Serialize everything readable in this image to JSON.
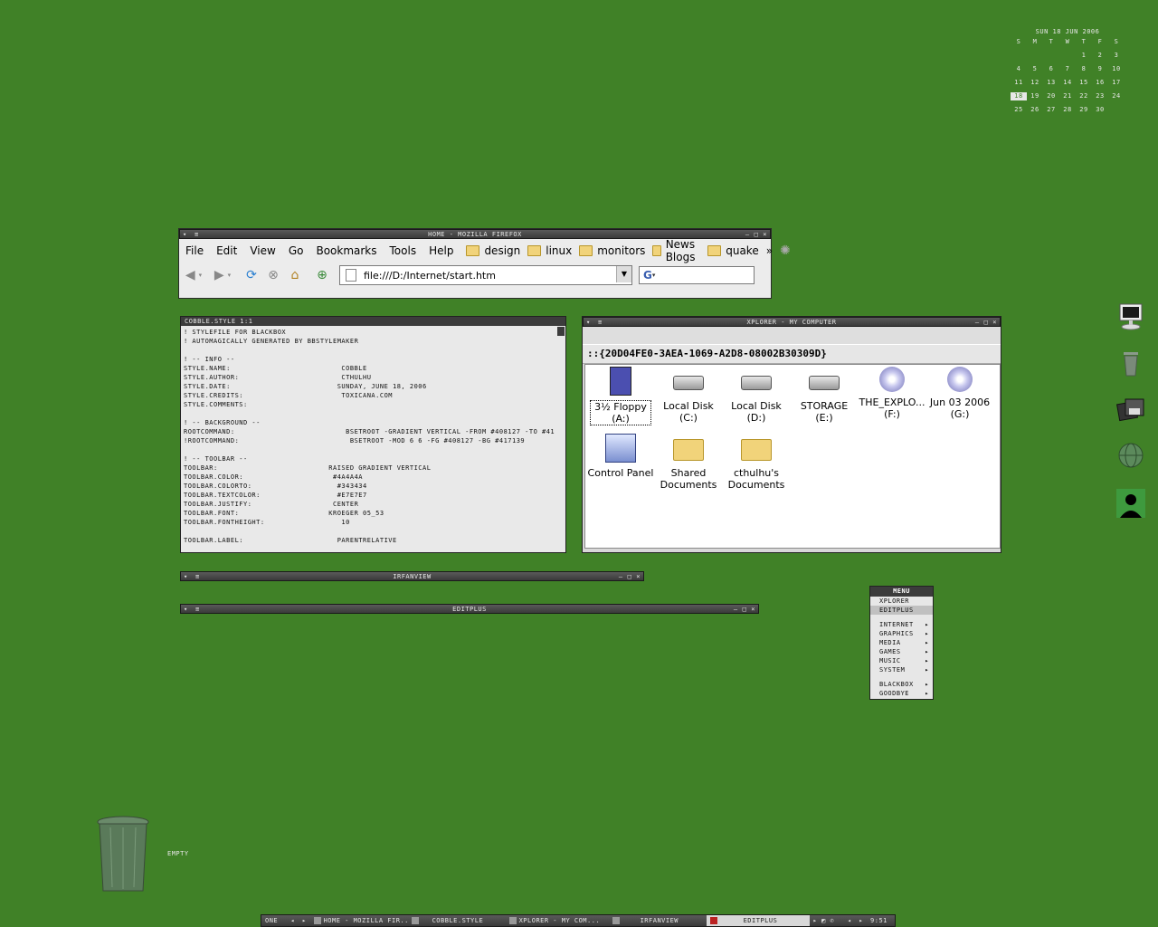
{
  "calendar": {
    "title": "Sun 18 Jun 2006",
    "dow": [
      "S",
      "M",
      "T",
      "W",
      "T",
      "F",
      "S"
    ],
    "weeks": [
      [
        "",
        "",
        "",
        "",
        "1",
        "2",
        "3"
      ],
      [
        "4",
        "5",
        "6",
        "7",
        "8",
        "9",
        "10"
      ],
      [
        "11",
        "12",
        "13",
        "14",
        "15",
        "16",
        "17"
      ],
      [
        "18",
        "19",
        "20",
        "21",
        "22",
        "23",
        "24"
      ],
      [
        "25",
        "26",
        "27",
        "28",
        "29",
        "30",
        ""
      ]
    ],
    "today": "18"
  },
  "firefox": {
    "title": "Home - Mozilla Firefox",
    "menu": [
      "File",
      "Edit",
      "View",
      "Go",
      "Bookmarks",
      "Tools",
      "Help"
    ],
    "bookmarks": [
      "design",
      "linux",
      "monitors",
      "News Blogs",
      "quake"
    ],
    "overflow": "»",
    "url": "file:///D:/Internet/start.htm",
    "search_logo": "G"
  },
  "editor": {
    "header": "cobble.style   1:1",
    "lines": [
      "! stylefile for blackbox",
      "! automagically generated by bbstylemaker",
      "",
      "! -- info --",
      "style.name:                          cobble",
      "style.author:                        cthulhu",
      "style.date:                         sunday, june 18, 2006",
      "style.credits:                       toxicana.com",
      "style.comments:",
      "",
      "! -- background --",
      "rootcommand:                          bsetroot -gradient vertical -from #408127 -to #41",
      "!rootcommand:                          bsetroot -mod 6 6 -fg #408127 -bg #417139",
      "",
      "! -- toolbar --",
      "toolbar:                          raised gradient vertical",
      "toolbar.color:                     #4a4a4a",
      "toolbar.colorto:                    #343434",
      "toolbar.textcolor:                  #e7e7e7",
      "toolbar.justify:                   center",
      "toolbar.font:                     kroeger 05_53",
      "toolbar.fontheight:                  10",
      "",
      "toolbar.label:                      parentrelative"
    ]
  },
  "xplorer": {
    "title": "xplorer - My Computer",
    "address": "::{20D04FE0-3AEA-1069-A2D8-08002B30309D}",
    "icons": [
      {
        "label1": "3½ Floppy",
        "label2": "(A:)",
        "icon": "floppy-icon"
      },
      {
        "label1": "Local Disk (C:)",
        "label2": "",
        "icon": "hard-disk-icon"
      },
      {
        "label1": "Local Disk (D:)",
        "label2": "",
        "icon": "hard-disk-icon"
      },
      {
        "label1": "STORAGE (E:)",
        "label2": "",
        "icon": "hard-disk-icon"
      },
      {
        "label1": "THE_EXPLO...",
        "label2": "(F:)",
        "icon": "cd-drive-icon"
      },
      {
        "label1": "Jun 03 2006",
        "label2": "(G:)",
        "icon": "cd-drive-icon"
      },
      {
        "label1": "Control Panel",
        "label2": "",
        "icon": "control-panel-icon"
      },
      {
        "label1": "Shared",
        "label2": "Documents",
        "icon": "folder-icon"
      },
      {
        "label1": "cthulhu's",
        "label2": "Documents",
        "icon": "folder-icon"
      }
    ]
  },
  "irfanview": {
    "title": "IrfanView"
  },
  "editplus": {
    "title": "EditPlus"
  },
  "menu": {
    "title": "Menu",
    "items": [
      {
        "label": "Xplorer",
        "sub": false,
        "hl": false
      },
      {
        "label": "EditPlus",
        "sub": false,
        "hl": true
      },
      {
        "sep": true
      },
      {
        "label": "Internet",
        "sub": true
      },
      {
        "label": "Graphics",
        "sub": true
      },
      {
        "label": "Media",
        "sub": true
      },
      {
        "label": "Games",
        "sub": true
      },
      {
        "label": "Music",
        "sub": true
      },
      {
        "label": "System",
        "sub": true
      },
      {
        "sep": true
      },
      {
        "label": "Blackbox",
        "sub": true
      },
      {
        "label": "Goodbye",
        "sub": true
      }
    ]
  },
  "desktop": {
    "trash_label": "empty"
  },
  "taskbar": {
    "workspace": "one",
    "tasks": [
      {
        "label": "Home - Mozilla Fir...",
        "active": false
      },
      {
        "label": "cobble.style",
        "active": false
      },
      {
        "label": "xplorer - My Com...",
        "active": false
      },
      {
        "label": "IrfanView",
        "active": false
      },
      {
        "label": "EditPlus",
        "active": true
      }
    ],
    "clock": "9:51"
  },
  "colors": {
    "desktop": "#408127",
    "toolbar": "#4a4a4a",
    "toolbar_to": "#343434",
    "text": "#e7e7e7"
  }
}
